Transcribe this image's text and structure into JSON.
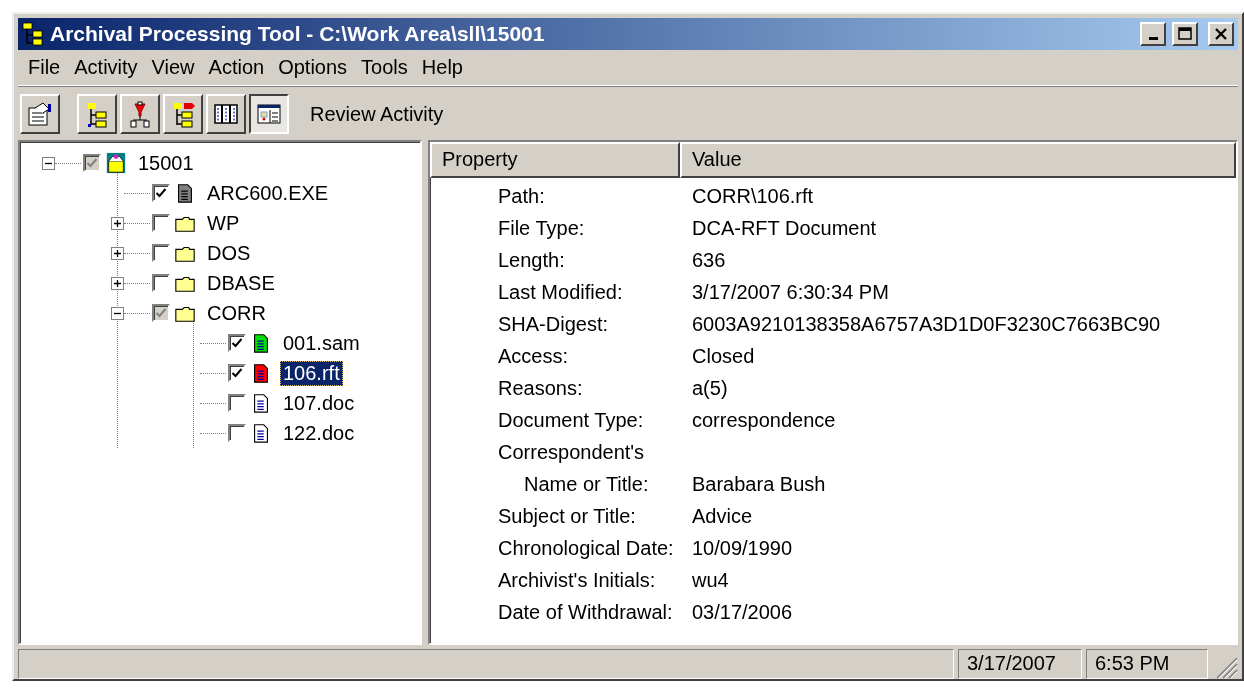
{
  "window": {
    "title": "Archival Processing Tool - C:\\Work Area\\sll\\15001"
  },
  "menu": [
    "File",
    "Activity",
    "View",
    "Action",
    "Options",
    "Tools",
    "Help"
  ],
  "toolbar": {
    "buttons": [
      {
        "kind": "properties",
        "pressed": false
      },
      {
        "kind": "tree-add",
        "pressed": false
      },
      {
        "kind": "tree-filter",
        "pressed": false
      },
      {
        "kind": "tree-mark",
        "pressed": false
      },
      {
        "kind": "columns",
        "pressed": false
      },
      {
        "kind": "review",
        "pressed": true
      }
    ],
    "label": "Review Activity"
  },
  "tree": [
    {
      "label": "15001",
      "kind": "project",
      "checked": true,
      "partial": true,
      "expanded": true,
      "selected": false,
      "children": [
        {
          "label": "ARC600.EXE",
          "kind": "file",
          "color": "#808080",
          "checked": true,
          "partial": false,
          "selected": false
        },
        {
          "label": "WP",
          "kind": "folder",
          "checked": false,
          "partial": false,
          "expanded": false,
          "selected": false
        },
        {
          "label": "DOS",
          "kind": "folder",
          "checked": false,
          "partial": false,
          "expanded": false,
          "selected": false
        },
        {
          "label": "DBASE",
          "kind": "folder",
          "checked": false,
          "partial": false,
          "expanded": false,
          "selected": false
        },
        {
          "label": "CORR",
          "kind": "folder",
          "checked": true,
          "partial": true,
          "expanded": true,
          "selected": false,
          "children": [
            {
              "label": "001.sam",
              "kind": "file",
              "color": "#00e000",
              "checked": true,
              "partial": false,
              "selected": false
            },
            {
              "label": "106.rft",
              "kind": "file",
              "color": "#ff0000",
              "checked": true,
              "partial": false,
              "selected": true
            },
            {
              "label": "107.doc",
              "kind": "file",
              "checked": false,
              "partial": false,
              "selected": false
            },
            {
              "label": "122.doc",
              "kind": "file",
              "checked": false,
              "partial": false,
              "selected": false
            }
          ]
        }
      ]
    }
  ],
  "properties": {
    "columns": [
      "Property",
      "Value"
    ],
    "rows": [
      {
        "kind": "field",
        "property": "Path:",
        "value": "CORR\\106.rft"
      },
      {
        "kind": "field",
        "property": "File Type:",
        "value": "DCA-RFT Document"
      },
      {
        "kind": "field",
        "property": "Length:",
        "value": "636"
      },
      {
        "kind": "field",
        "property": "Last Modified:",
        "value": "3/17/2007 6:30:34 PM"
      },
      {
        "kind": "field",
        "property": "SHA-Digest:",
        "value": "6003A9210138358A6757A3D1D0F3230C7663BC90"
      },
      {
        "kind": "field",
        "property": "Access:",
        "value": "Closed"
      },
      {
        "kind": "field",
        "property": "Reasons:",
        "value": "a(5)"
      },
      {
        "kind": "field",
        "property": "Document Type:",
        "value": "correspondence"
      },
      {
        "kind": "field",
        "property": "Correspondent's"
      },
      {
        "kind": "sub",
        "property": "Name or Title:",
        "value": "Barabara Bush"
      },
      {
        "kind": "field",
        "property": "Subject or Title:",
        "value": "Advice"
      },
      {
        "kind": "field",
        "property": "Chronological Date:",
        "value": "10/09/1990"
      },
      {
        "kind": "field",
        "property": "Archivist's Initials:",
        "value": "wu4"
      },
      {
        "kind": "field",
        "property": "Date of Withdrawal:",
        "value": "03/17/2006"
      }
    ]
  },
  "status_bar": [
    "3/17/2007",
    "6:53 PM"
  ]
}
